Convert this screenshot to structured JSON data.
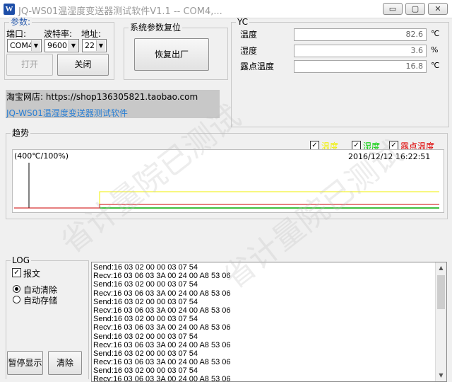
{
  "window": {
    "title": "JQ-WS01温湿度变送器测试软件V1.1 -- COM4,...",
    "icon_letter": "W",
    "minimize": "▭",
    "maximize": "▢",
    "close": "✕"
  },
  "params": {
    "title": "参数:",
    "port_label": "端口:",
    "baud_label": "波特率:",
    "addr_label": "地址:",
    "port_value": "COM4",
    "baud_value": "9600",
    "addr_value": "22",
    "open_button": "打开",
    "close_button": "关闭"
  },
  "reset": {
    "title": "系统参数复位",
    "button": "恢复出厂"
  },
  "yc": {
    "title": "YC",
    "rows": [
      {
        "label": "温度",
        "value": "82.6",
        "unit": "℃"
      },
      {
        "label": "湿度",
        "value": "3.6",
        "unit": "%"
      },
      {
        "label": "露点温度",
        "value": "16.8",
        "unit": "℃"
      }
    ]
  },
  "shop": {
    "line1": "淘宝网店:  https://shop136305821.taobao.com",
    "line2": "JQ-WS01温湿度变送器测试软件"
  },
  "trend": {
    "title": "趋势",
    "scale_label": "(400℃/100%)",
    "timestamp": "2016/12/12 16:22:51",
    "legend": [
      {
        "label": "温度",
        "color": "#f0f000",
        "checked": true
      },
      {
        "label": "湿度",
        "color": "#00cc00",
        "checked": true
      },
      {
        "label": "露点温度",
        "color": "#dd0000",
        "checked": true
      }
    ],
    "series_colors": {
      "temperature": "#f0f000",
      "humidity": "#00aa00",
      "dewpoint": "#cc0000"
    }
  },
  "log": {
    "title": "LOG",
    "message_checkbox": "报文",
    "message_checked": true,
    "auto_clear": "自动清除",
    "auto_save": "自动存储",
    "auto_clear_selected": true,
    "pause_button": "暂停显示",
    "clear_button": "清除",
    "lines": [
      "Send:16 03 02 00 00 03 07 54",
      "Recv:16 03 06 03 3A 00 24 00 A8 53 06",
      "Send:16 03 02 00 00 03 07 54",
      "Recv:16 03 06 03 3A 00 24 00 A8 53 06",
      "Send:16 03 02 00 00 03 07 54",
      "Recv:16 03 06 03 3A 00 24 00 A8 53 06",
      "Send:16 03 02 00 00 03 07 54",
      "Recv:16 03 06 03 3A 00 24 00 A8 53 06",
      "Send:16 03 02 00 00 03 07 54",
      "Recv:16 03 06 03 3A 00 24 00 A8 53 06",
      "Send:16 03 02 00 00 03 07 54",
      "Recv:16 03 06 03 3A 00 24 00 A8 53 06",
      "Send:16 03 02 00 00 03 07 54",
      "Recv:16 03 06 03 3A 00 24 00 A8 53 06"
    ]
  },
  "watermark": "省计量院已测试"
}
